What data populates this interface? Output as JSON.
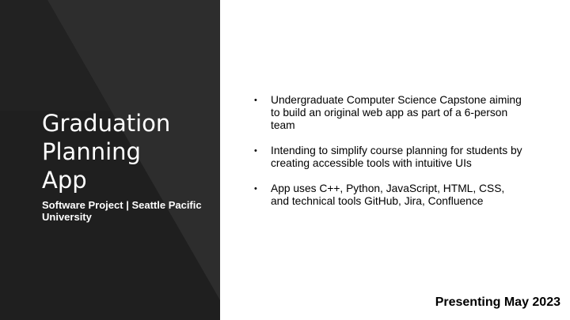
{
  "slide": {
    "title": "Graduation\nPlanning\nApp",
    "subtitle": "Software Project | Seattle Pacific University",
    "bullets": [
      "Undergraduate Computer Science Capstone aiming to build an original web app as part of a 6-person team",
      "Intending to simplify course planning for students by creating accessible tools with intuitive UIs",
      "App uses C++, Python, JavaScript, HTML, CSS, and technical tools GitHub, Jira, Confluence"
    ],
    "bullet_glyph": "•",
    "footer": "Presenting May 2023"
  },
  "colors": {
    "panel_dark": "#1e1e1e",
    "panel_light": "#2d2d2d",
    "text_on_dark": "#ffffff",
    "text_on_light": "#000000"
  }
}
